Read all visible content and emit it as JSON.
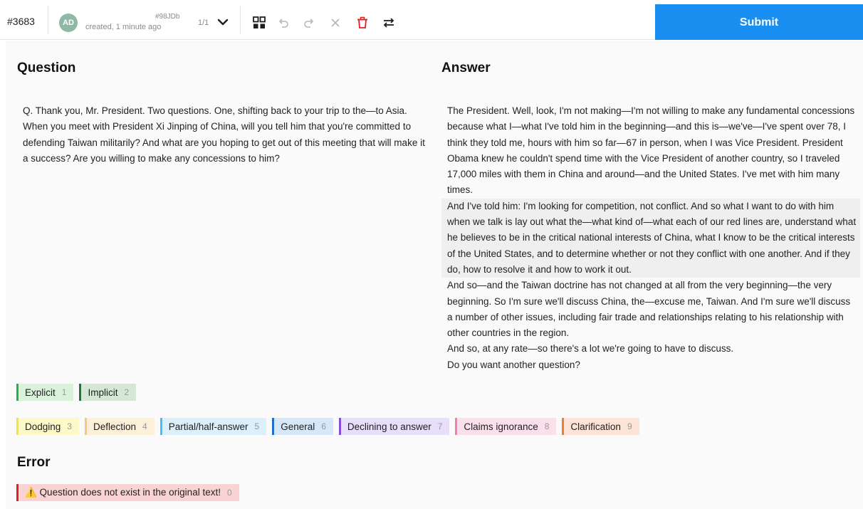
{
  "header": {
    "task_id": "#3683",
    "avatar_initials": "AD",
    "annotation_id": "#98JDb",
    "created": "created, 1 minute ago",
    "pager": "1/1",
    "submit_label": "Submit",
    "tools": [
      "grid-icon",
      "undo-icon",
      "redo-icon",
      "clear-icon",
      "delete-icon",
      "swap-icon"
    ]
  },
  "question": {
    "title": "Question",
    "text": "Q. Thank you, Mr. President. Two questions. One, shifting back to your trip to the—to Asia. When you meet with President Xi Jinping of China, will you tell him that you're committed to defending Taiwan militarily? And what are you hoping to get out of this meeting that will make it a success? Are you willing to make any concessions to him?"
  },
  "answer": {
    "title": "Answer",
    "paragraphs": [
      "The President. Well, look, I'm not making—I'm not willing to make any fundamental concessions because what I—what I've told him in the beginning—and this is—we've—I've spent over 78, I think they told me, hours with him so far—67 in person, when I was Vice President. President Obama knew he couldn't spend time with the Vice President of another country, so I traveled 17,000 miles with them in China and around—and the United States. I've met with him many times.",
      "And I've told him: I'm looking for competition, not conflict. And so what I want to do with him when we talk is lay out what the—what kind of—what each of our red lines are, understand what he believes to be in the critical national interests of China, what I know to be the critical interests of the United States, and to determine whether or not they conflict with one another. And if they do, how to resolve it and how to work it out.",
      "And so—and the Taiwan doctrine has not changed at all from the very beginning—the very beginning. So I'm sure we'll discuss China, the—excuse me, Taiwan. And I'm sure we'll discuss a number of other issues, including fair trade and relationships relating to his relationship with other countries in the region.",
      "And so, at any rate—so there's a lot we're going to have to discuss.",
      "Do you want another question?"
    ]
  },
  "labels_row1": [
    {
      "label": "Explicit",
      "key": "1",
      "bg": "#d9f2d9",
      "border": "#22b14c"
    },
    {
      "label": "Implicit",
      "key": "2",
      "bg": "#d5e8d5",
      "border": "#1e7a33"
    }
  ],
  "labels_row2": [
    {
      "label": "Dodging",
      "key": "3",
      "bg": "#fdf9c8",
      "border": "#f5e52b"
    },
    {
      "label": "Deflection",
      "key": "4",
      "bg": "#fdf0d8",
      "border": "#f7c77a"
    },
    {
      "label": "Partial/half-answer",
      "key": "5",
      "bg": "#dbf0fb",
      "border": "#43c2f0"
    },
    {
      "label": "General",
      "key": "6",
      "bg": "#d6e7f8",
      "border": "#1f6fd1"
    },
    {
      "label": "Declining to answer",
      "key": "7",
      "bg": "#e7defa",
      "border": "#8a4dd8"
    },
    {
      "label": "Claims ignorance",
      "key": "8",
      "bg": "#fbe0ec",
      "border": "#f27fb3"
    },
    {
      "label": "Clarification",
      "key": "9",
      "bg": "#fde4d6",
      "border": "#f07a3a"
    }
  ],
  "error": {
    "title": "Error",
    "labels": [
      {
        "label": "⚠️ Question does not exist in the original text!",
        "key": "0",
        "bg": "#fad4d4",
        "border": "#e21f26"
      }
    ]
  },
  "colors": {
    "submit": "#1a8ff2",
    "delete": "#e21f26"
  }
}
